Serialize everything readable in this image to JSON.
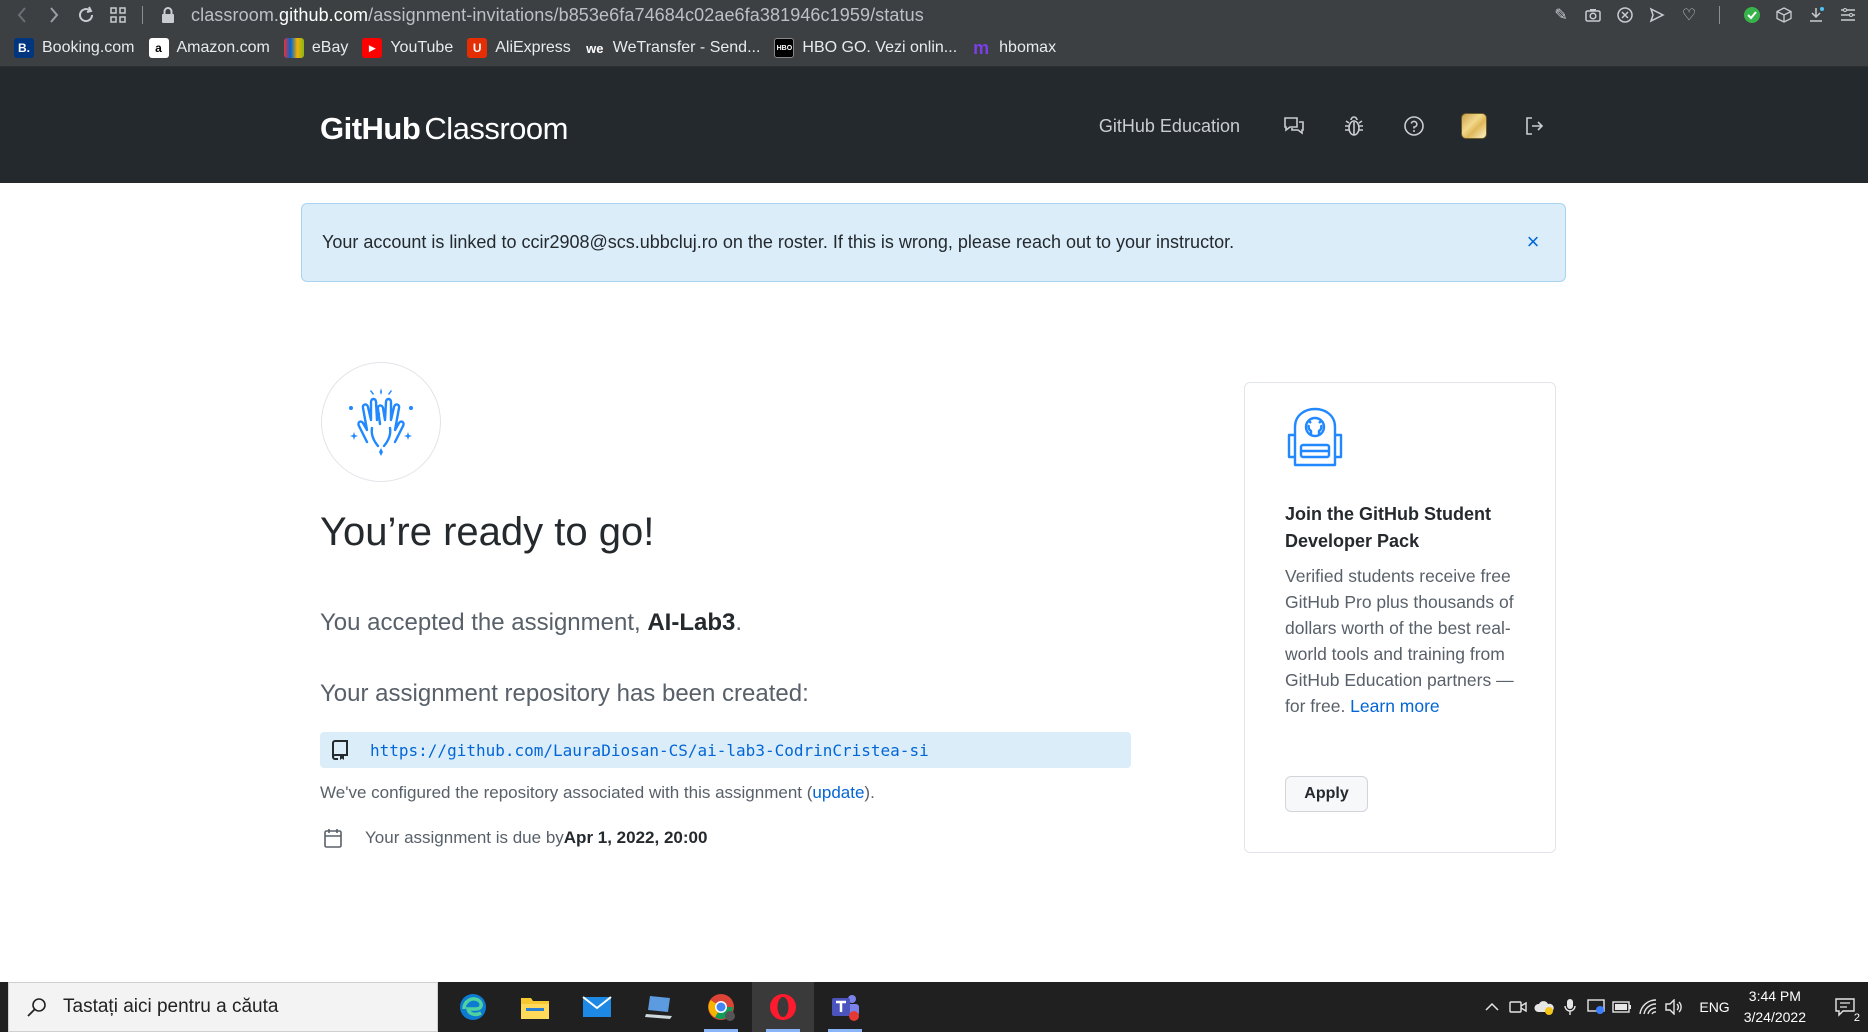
{
  "browser": {
    "url_prefix": "classroom.",
    "url_domain": "github.com",
    "url_path": "/assignment-invitations/b853e6fa74684c02ae6fa381946c1959/status"
  },
  "bookmarks": [
    {
      "label": "Booking.com",
      "icon": "B.",
      "color": "#003580"
    },
    {
      "label": "Amazon.com",
      "icon": "a",
      "color": "#ffffff"
    },
    {
      "label": "eBay",
      "icon": "e",
      "color": "#e53238"
    },
    {
      "label": "YouTube",
      "icon": "▶",
      "color": "#ff0000"
    },
    {
      "label": "AliExpress",
      "icon": "A",
      "color": "#e62e04"
    },
    {
      "label": "WeTransfer - Send...",
      "icon": "we",
      "color": "#3c4043"
    },
    {
      "label": "HBO GO. Vezi onlin...",
      "icon": "HBO",
      "color": "#000000"
    },
    {
      "label": "hbomax",
      "icon": "m",
      "color": "#5822b4"
    }
  ],
  "header": {
    "logo_bold": "GitHub",
    "logo_light": "Classroom",
    "education_link": "GitHub Education"
  },
  "alert": {
    "text": "Your account is linked to ccir2908@scs.ubbcluj.ro on the roster. If this is wrong, please reach out to your instructor.",
    "close": "×"
  },
  "main": {
    "title": "You’re ready to go!",
    "accepted_prefix": "You accepted the assignment, ",
    "assignment_name": "AI-Lab3",
    "accepted_suffix": ".",
    "repo_created": "Your assignment repository has been created:",
    "repo_url": "https://github.com/LauraDiosan-CS/ai-lab3-CodrinCristea-si",
    "config_prefix": "We've configured the repository associated with this assignment (",
    "config_link": "update",
    "config_suffix": ").",
    "due_prefix": "Your assignment is due by ",
    "due_date": "Apr 1, 2022, 20:00"
  },
  "card": {
    "title": "Join the GitHub Student Developer Pack",
    "body": "Verified students receive free GitHub Pro plus thousands of dollars worth of the best real-world tools and training from GitHub Education partners — for free. ",
    "learn_more": "Learn more",
    "apply": "Apply"
  },
  "taskbar": {
    "search_placeholder": "Tastați aici pentru a căuta",
    "language": "ENG",
    "time": "3:44 PM",
    "date": "3/24/2022",
    "notification_count": "2"
  },
  "colors": {
    "header_bg": "#24292e",
    "link": "#0366d6",
    "alert_bg": "#dbedf9",
    "illustration": "#2188ff"
  }
}
